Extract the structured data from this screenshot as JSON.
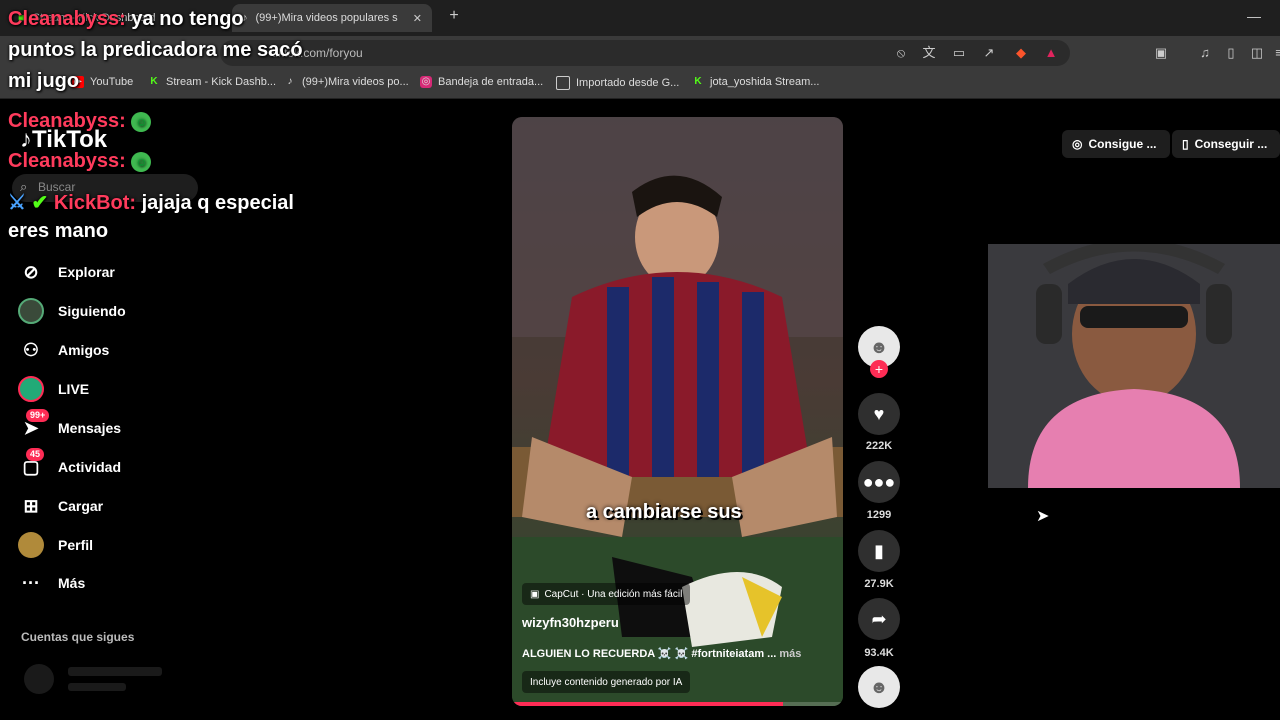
{
  "browser": {
    "tabs": [
      {
        "title": "Stream - Kick Dashboard"
      },
      {
        "title": "(99+)Mira videos populares s"
      }
    ],
    "url": "tiktok.com/foryou",
    "bookmarks": [
      {
        "label": "YouTube",
        "icon": "youtube-icon"
      },
      {
        "label": "Stream - Kick Dashb...",
        "icon": "kick-icon"
      },
      {
        "label": "(99+)Mira videos po...",
        "icon": "tiktok-icon"
      },
      {
        "label": "Bandeja de entrada...",
        "icon": "instagram-icon"
      },
      {
        "label": "Importado desde G...",
        "icon": "folder-icon"
      },
      {
        "label": "jota_yoshida Stream...",
        "icon": "kick-icon"
      }
    ]
  },
  "chat": {
    "messages": [
      {
        "user": "Cleanabyss:",
        "text": "ya no tengo puntos la predicadora me sacó mi jugo"
      },
      {
        "user": "Cleanabyss:",
        "text": ""
      },
      {
        "user": "Cleanabyss:",
        "text": ""
      },
      {
        "user": "KickBot:",
        "text": "jajaja q especial eres mano"
      }
    ],
    "line1b": "puntos la predicadora me sacó",
    "line1c": "mi jugo",
    "line1a": "ya no tengo",
    "line4b": "eres mano",
    "line4a": "jajaja q especial"
  },
  "tiktok": {
    "logo": "TikTok",
    "search_placeholder": "Buscar",
    "nav": [
      {
        "label": "Explorar",
        "icon": "compass-icon"
      },
      {
        "label": "Siguiendo",
        "icon": "following-avatar-icon"
      },
      {
        "label": "Amigos",
        "icon": "friends-icon"
      },
      {
        "label": "LIVE",
        "icon": "live-icon"
      },
      {
        "label": "Mensajes",
        "icon": "messages-icon",
        "badge": "99+"
      },
      {
        "label": "Actividad",
        "icon": "activity-icon",
        "badge": "45"
      },
      {
        "label": "Cargar",
        "icon": "upload-icon"
      },
      {
        "label": "Perfil",
        "icon": "profile-avatar-icon"
      },
      {
        "label": "Más",
        "icon": "more-icon"
      }
    ],
    "following_header": "Cuentas que sigues",
    "top_right": {
      "get_coins": "Consigue ...",
      "get_app": "Conseguir ..."
    }
  },
  "video": {
    "caption_overlay": "a cambiarse sus",
    "capcut_label": "CapCut · Una edición más fácil",
    "author": "wizyfn30hzperu",
    "description": "ALGUIEN LO RECUERDA ☠️ ☠️ #fortniteiatam ...",
    "more_label": "más",
    "ai_label": "Incluye contenido generado por IA",
    "progress": 0.82,
    "likes": "222K",
    "comments": "1299",
    "saves": "27.9K",
    "shares": "93.4K"
  },
  "colors": {
    "accent": "#fe2c55",
    "kick_green": "#53fc18"
  }
}
